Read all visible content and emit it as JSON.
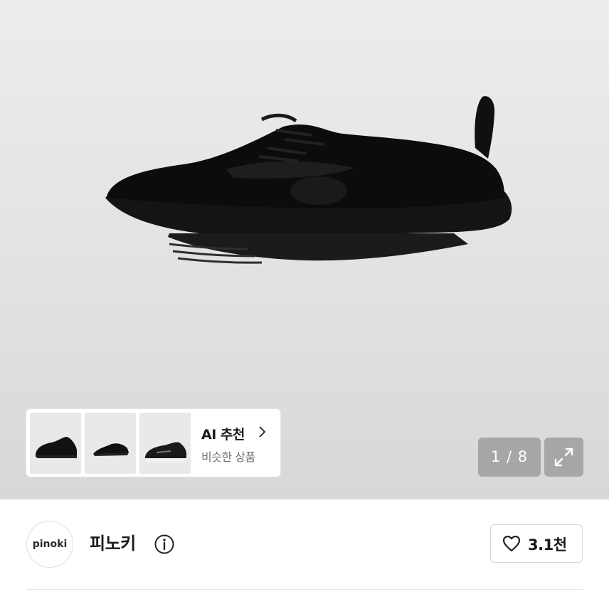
{
  "gallery": {
    "main_image_icon": "black-sneaker-photo",
    "ai_recommend": {
      "title": "AI 추천",
      "subtitle": "비슷한 상품",
      "thumbnails": [
        "black-sneaker-side",
        "black-sneaker-low",
        "black-sneaker-white-sole"
      ]
    },
    "page_counter": "1 / 8",
    "expand_icon": "expand-arrows-icon"
  },
  "store": {
    "avatar_text": "pinoki",
    "name": "피노키",
    "info_icon": "info-icon",
    "like_icon": "heart-icon",
    "like_count": "3.1천"
  },
  "colors": {
    "hero_bg": "#e3e3e3",
    "overlay_bg": "#969696",
    "text_primary": "#1a1a1a"
  }
}
